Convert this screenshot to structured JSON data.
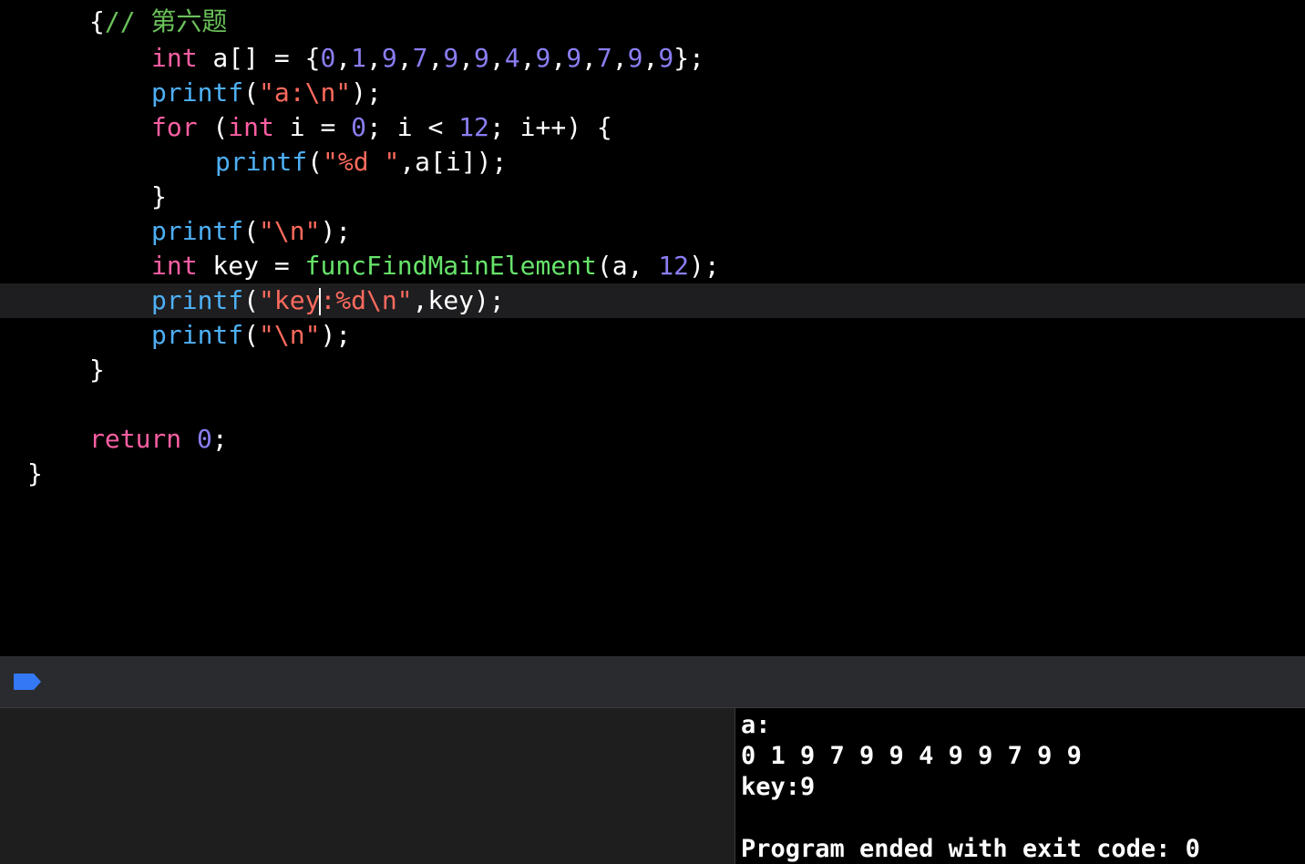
{
  "colors": {
    "plain": "#ffffff",
    "keyword": "#fc5fa3",
    "func": "#4eb0f5",
    "string": "#fc6a5d",
    "number": "#8a7ef2",
    "comment": "#6bc25a",
    "userfunc": "#67e36a",
    "current_line_bg": "#1e1e20",
    "breakpoint": "#3478f6"
  },
  "code_lines": [
    [
      [
        "{",
        "plain"
      ],
      [
        "// 第六题",
        "comment"
      ]
    ],
    [
      [
        "int",
        "keyword"
      ],
      [
        " a[] = {",
        "plain"
      ],
      [
        "0",
        "number"
      ],
      [
        ",",
        "plain"
      ],
      [
        "1",
        "number"
      ],
      [
        ",",
        "plain"
      ],
      [
        "9",
        "number"
      ],
      [
        ",",
        "plain"
      ],
      [
        "7",
        "number"
      ],
      [
        ",",
        "plain"
      ],
      [
        "9",
        "number"
      ],
      [
        ",",
        "plain"
      ],
      [
        "9",
        "number"
      ],
      [
        ",",
        "plain"
      ],
      [
        "4",
        "number"
      ],
      [
        ",",
        "plain"
      ],
      [
        "9",
        "number"
      ],
      [
        ",",
        "plain"
      ],
      [
        "9",
        "number"
      ],
      [
        ",",
        "plain"
      ],
      [
        "7",
        "number"
      ],
      [
        ",",
        "plain"
      ],
      [
        "9",
        "number"
      ],
      [
        ",",
        "plain"
      ],
      [
        "9",
        "number"
      ],
      [
        "};",
        "plain"
      ]
    ],
    [
      [
        "printf",
        "func"
      ],
      [
        "(",
        "plain"
      ],
      [
        "\"a:\\n\"",
        "string"
      ],
      [
        ");",
        "plain"
      ]
    ],
    [
      [
        "for",
        "keyword"
      ],
      [
        " (",
        "plain"
      ],
      [
        "int",
        "keyword"
      ],
      [
        " i = ",
        "plain"
      ],
      [
        "0",
        "number"
      ],
      [
        "; i < ",
        "plain"
      ],
      [
        "12",
        "number"
      ],
      [
        "; i++) {",
        "plain"
      ]
    ],
    [
      [
        "printf",
        "func"
      ],
      [
        "(",
        "plain"
      ],
      [
        "\"%d \"",
        "string"
      ],
      [
        ",a[i]);",
        "plain"
      ]
    ],
    [
      [
        "}",
        "plain"
      ]
    ],
    [
      [
        "printf",
        "func"
      ],
      [
        "(",
        "plain"
      ],
      [
        "\"\\n\"",
        "string"
      ],
      [
        ");",
        "plain"
      ]
    ],
    [
      [
        "int",
        "keyword"
      ],
      [
        " key = ",
        "plain"
      ],
      [
        "funcFindMainElement",
        "userfunc"
      ],
      [
        "(a, ",
        "plain"
      ],
      [
        "12",
        "number"
      ],
      [
        ");",
        "plain"
      ]
    ],
    [
      [
        "printf",
        "func"
      ],
      [
        "(",
        "plain"
      ],
      [
        "\"key",
        "string"
      ],
      [
        "|",
        "caret"
      ],
      [
        ":%d\\n\"",
        "string"
      ],
      [
        ",key);",
        "plain"
      ]
    ],
    [
      [
        "printf",
        "func"
      ],
      [
        "(",
        "plain"
      ],
      [
        "\"\\n\"",
        "string"
      ],
      [
        ");",
        "plain"
      ]
    ],
    [
      [
        "}",
        "plain"
      ]
    ],
    [],
    [
      [
        "return",
        "keyword"
      ],
      [
        " ",
        "plain"
      ],
      [
        "0",
        "number"
      ],
      [
        ";",
        "plain"
      ]
    ],
    [
      [
        "}",
        "plain"
      ]
    ]
  ],
  "console": {
    "lines": [
      "a:",
      "0 1 9 7 9 9 4 9 9 7 9 9",
      "key:9",
      "",
      "Program ended with exit code: 0"
    ]
  }
}
